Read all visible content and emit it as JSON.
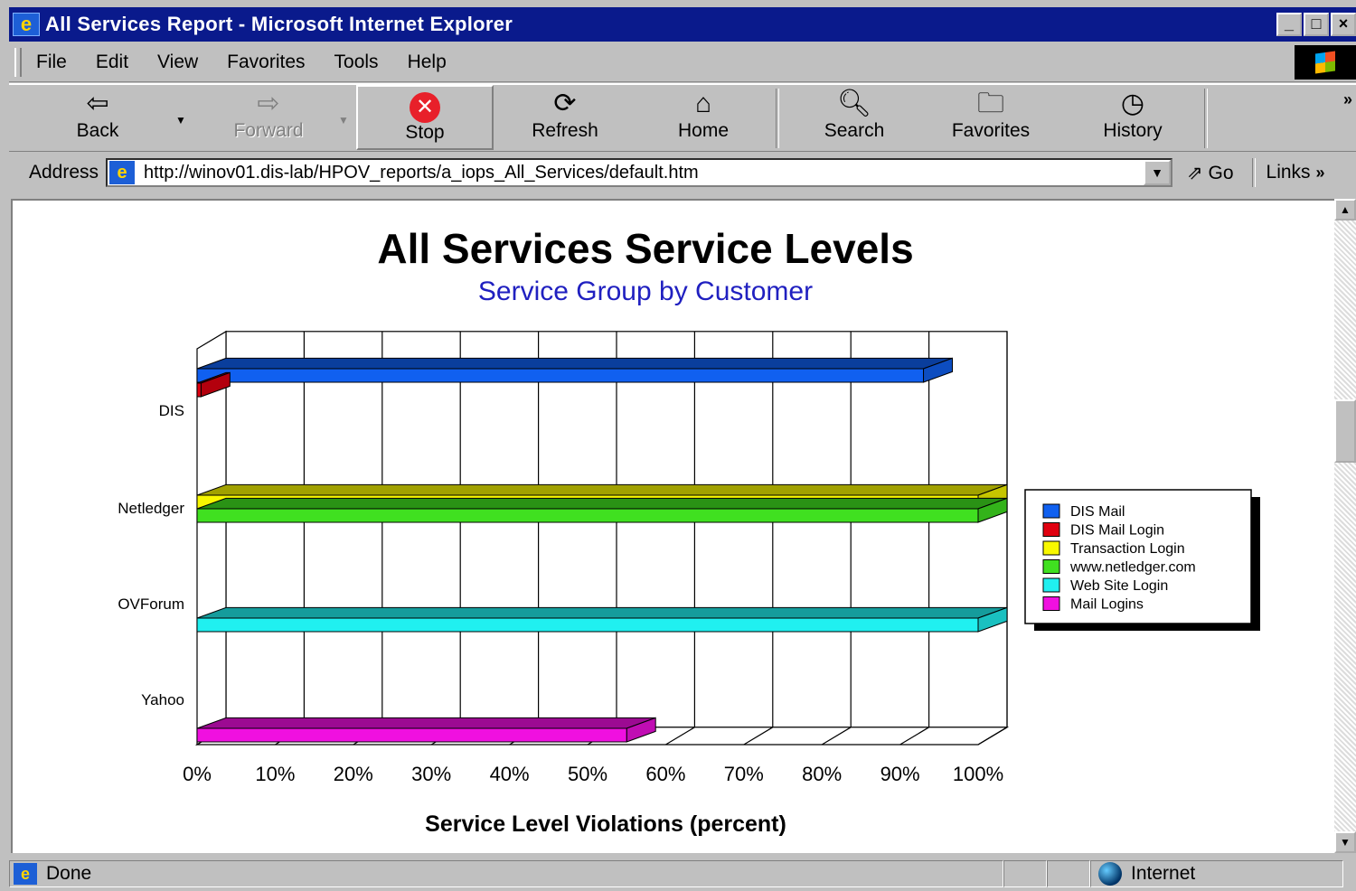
{
  "window": {
    "title": "All Services Report - Microsoft Internet Explorer",
    "controls": [
      "_",
      "□",
      "×"
    ]
  },
  "menu": {
    "items": [
      {
        "label": "File"
      },
      {
        "label": "Edit"
      },
      {
        "label": "View"
      },
      {
        "label": "Favorites"
      },
      {
        "label": "Tools"
      },
      {
        "label": "Help"
      }
    ]
  },
  "toolbar": {
    "back": "Back",
    "forward": "Forward",
    "stop": "Stop",
    "refresh": "Refresh",
    "home": "Home",
    "search": "Search",
    "favorites": "Favorites",
    "history": "History"
  },
  "address": {
    "label": "Address",
    "url": "http://winov01.dis-lab/HPOV_reports/a_iops_All_Services/default.htm",
    "go": "Go",
    "links": "Links"
  },
  "status": {
    "text": "Done",
    "zone": "Internet"
  },
  "colors": {
    "dis_mail": "#1060f0",
    "dis_mail_login": "#e00010",
    "transaction_login": "#f8f800",
    "netledger": "#40e020",
    "web_site_login": "#20f0f0",
    "mail_logins": "#f010e0"
  },
  "chart_data": {
    "type": "bar",
    "orientation": "horizontal",
    "title": "All Services Service Levels",
    "subtitle": "Service Group by Customer",
    "xlabel": "Service Level Violations (percent)",
    "ylabel": "",
    "categories": [
      "DIS",
      "Netledger",
      "OVForum",
      "Yahoo"
    ],
    "xlim": [
      0,
      100
    ],
    "ticks": [
      "0%",
      "10%",
      "20%",
      "30%",
      "40%",
      "50%",
      "60%",
      "70%",
      "80%",
      "90%",
      "100%"
    ],
    "grid": true,
    "legend_position": "right",
    "series": [
      {
        "name": "DIS Mail",
        "values": [
          93,
          null,
          null,
          null
        ]
      },
      {
        "name": "DIS Mail Login",
        "values": [
          0.5,
          null,
          null,
          null
        ]
      },
      {
        "name": "Transaction Login",
        "values": [
          null,
          100,
          null,
          null
        ]
      },
      {
        "name": "www.netledger.com",
        "values": [
          null,
          100,
          null,
          null
        ]
      },
      {
        "name": "Web Site Login",
        "values": [
          null,
          null,
          100,
          null
        ]
      },
      {
        "name": "Mail Logins",
        "values": [
          null,
          null,
          null,
          55
        ]
      }
    ]
  }
}
